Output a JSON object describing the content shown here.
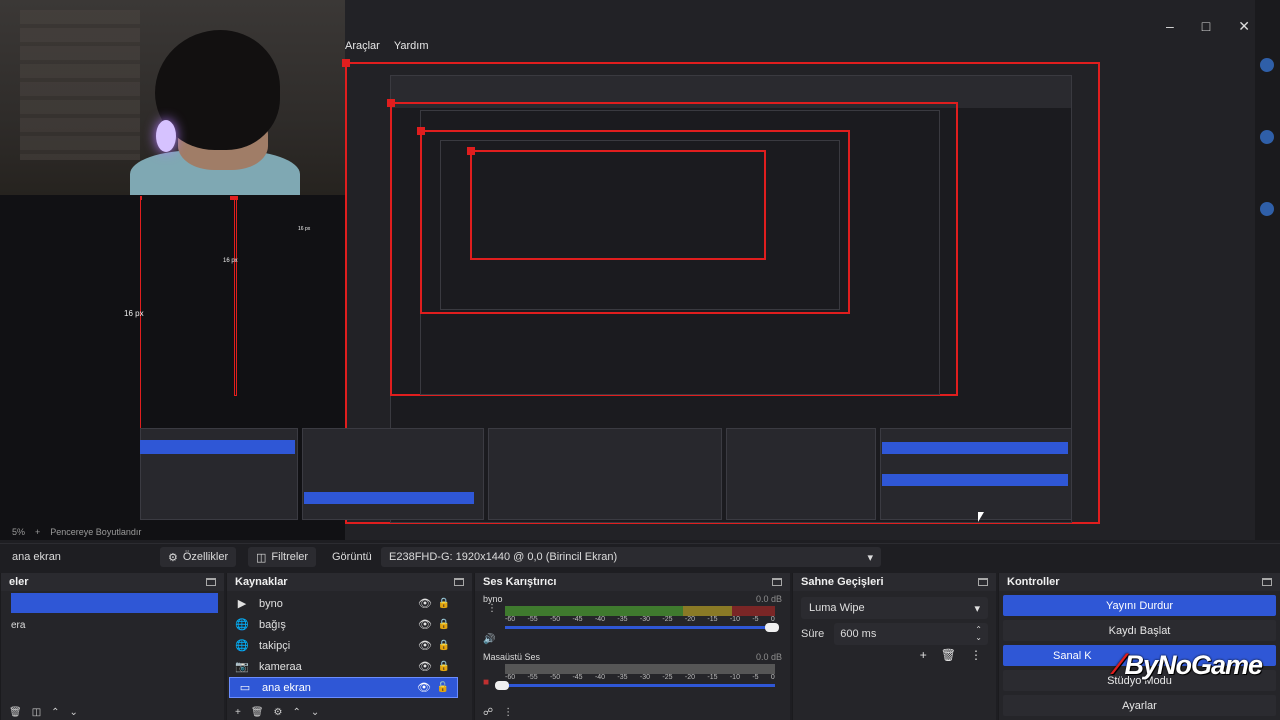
{
  "menu": {
    "items": [
      "Araçlar",
      "Yardım"
    ]
  },
  "window": {
    "minimize_icon": "minimize-icon",
    "maximize_icon": "maximize-icon",
    "close_icon": "close-icon"
  },
  "preview": {
    "measurements": [
      "16 px",
      "16 px",
      "16 px"
    ],
    "status_zoom": "5%",
    "status_add": "+",
    "status_text": "Pencereye Boyutlandır",
    "brand": "ByNoGame"
  },
  "toolbar": {
    "scene_name": "ana ekran",
    "properties_label": "Özellikler",
    "filters_label": "Filtreler",
    "display_label": "Görüntü",
    "display_value": "E238FHD-G: 1920x1440 @ 0,0 (Birincil Ekran)"
  },
  "scenes": {
    "title": "eler",
    "items": [
      "",
      "era"
    ]
  },
  "sources": {
    "title": "Kaynaklar",
    "items": [
      {
        "name": "byno",
        "icon": "play-icon"
      },
      {
        "name": "bağış",
        "icon": "globe-icon"
      },
      {
        "name": "takipçi",
        "icon": "globe-icon"
      },
      {
        "name": "kameraa",
        "icon": "camera-icon"
      },
      {
        "name": "ana ekran",
        "icon": "monitor-icon"
      }
    ]
  },
  "mixer": {
    "title": "Ses Karıştırıcı",
    "channels": [
      {
        "name": "byno",
        "db": "0.0 dB",
        "level": 1.0
      },
      {
        "name": "Masaüstü Ses",
        "db": "0.0 dB",
        "level": 0.0
      }
    ],
    "ticks": [
      "-60",
      "-55",
      "-50",
      "-45",
      "-40",
      "-35",
      "-30",
      "-25",
      "-20",
      "-15",
      "-10",
      "-5",
      "0"
    ]
  },
  "transitions": {
    "title": "Sahne Geçişleri",
    "selected": "Luma Wipe",
    "duration_label": "Süre",
    "duration_value": "600 ms"
  },
  "controls": {
    "title": "Kontroller",
    "buttons": [
      "Yayını Durdur",
      "Kaydı Başlat",
      "Sanal K",
      "Stüdyo Modu",
      "Ayarlar"
    ]
  },
  "colors": {
    "accent": "#2f57d6",
    "panel": "#252529",
    "red_frame": "#e01e1e"
  }
}
